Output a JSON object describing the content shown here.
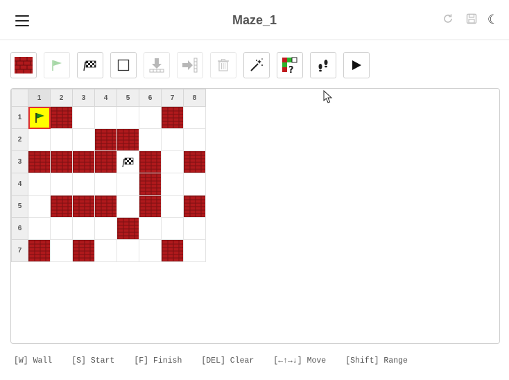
{
  "header": {
    "title": "Maze_1"
  },
  "toolbar": {
    "tools": [
      {
        "name": "wall",
        "icon": "brick-wall-icon"
      },
      {
        "name": "start",
        "icon": "flag-icon",
        "disabled": true
      },
      {
        "name": "finish",
        "icon": "checkered-flag-icon"
      },
      {
        "name": "clear",
        "icon": "empty-square-icon"
      },
      {
        "name": "insert-row",
        "icon": "insert-row-icon",
        "disabled": true
      },
      {
        "name": "insert-column",
        "icon": "insert-column-icon",
        "disabled": true
      },
      {
        "name": "delete",
        "icon": "trash-icon",
        "disabled": true
      },
      {
        "name": "generate",
        "icon": "magic-wand-icon"
      },
      {
        "name": "random",
        "icon": "random-cells-icon"
      },
      {
        "name": "step",
        "icon": "footsteps-icon"
      },
      {
        "name": "run",
        "icon": "play-icon"
      }
    ]
  },
  "grid": {
    "col_headers": [
      "1",
      "2",
      "3",
      "4",
      "5",
      "6",
      "7",
      "8"
    ],
    "row_headers": [
      "1",
      "2",
      "3",
      "4",
      "5",
      "6",
      "7"
    ],
    "selected_column": "1",
    "cells": [
      [
        "S",
        "W",
        ".",
        ".",
        ".",
        ".",
        "W",
        "."
      ],
      [
        ".",
        ".",
        ".",
        "W",
        "W",
        ".",
        ".",
        "."
      ],
      [
        "W",
        "W",
        "W",
        "W",
        "F",
        "W",
        ".",
        "W"
      ],
      [
        ".",
        ".",
        ".",
        ".",
        ".",
        "W",
        ".",
        "."
      ],
      [
        ".",
        "W",
        "W",
        "W",
        ".",
        "W",
        ".",
        "W"
      ],
      [
        ".",
        ".",
        ".",
        ".",
        "W",
        ".",
        ".",
        "."
      ],
      [
        "W",
        ".",
        "W",
        ".",
        ".",
        ".",
        "W",
        "."
      ]
    ]
  },
  "colors": {
    "wall": "#b0191c",
    "start_bg": "#ffff00",
    "start_border": "#e03030"
  },
  "footer": {
    "hints": [
      "[W] Wall",
      "[S] Start",
      "[F] Finish",
      "[DEL] Clear",
      "[←↑→↓] Move",
      "[Shift] Range"
    ]
  }
}
